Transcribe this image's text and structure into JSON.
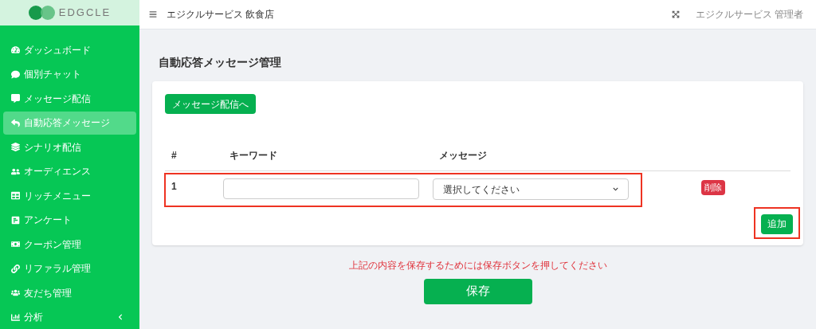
{
  "brand": {
    "name": "EDGCLE"
  },
  "sidebar": {
    "items": [
      {
        "label": "ダッシュボード",
        "selected": false,
        "kind": "link"
      },
      {
        "label": "個別チャット",
        "selected": false,
        "kind": "link"
      },
      {
        "label": "メッセージ配信",
        "selected": false,
        "kind": "link"
      },
      {
        "label": "自動応答メッセージ",
        "selected": true,
        "kind": "link"
      },
      {
        "label": "シナリオ配信",
        "selected": false,
        "kind": "link"
      },
      {
        "label": "オーディエンス",
        "selected": false,
        "kind": "link"
      },
      {
        "label": "リッチメニュー",
        "selected": false,
        "kind": "link"
      },
      {
        "label": "アンケート",
        "selected": false,
        "kind": "link"
      },
      {
        "label": "クーポン管理",
        "selected": false,
        "kind": "link"
      },
      {
        "label": "リファラル管理",
        "selected": false,
        "kind": "link"
      },
      {
        "label": "友だち管理",
        "selected": false,
        "kind": "link"
      },
      {
        "label": "分析",
        "selected": false,
        "kind": "group"
      }
    ]
  },
  "header": {
    "store": "エジクルサービス 飲食店",
    "user": "エジクルサービス 管理者"
  },
  "page_title": "自動応答メッセージ管理",
  "card": {
    "link_button": "メッセージ配信へ",
    "table": {
      "columns": [
        "#",
        "キーワード",
        "メッセージ"
      ],
      "rows": [
        {
          "number": "1",
          "message_select": "選択してください",
          "delete_button": "削除",
          "highlighted": true
        }
      ]
    },
    "add_button": {
      "label": "追加",
      "highlighted": true
    }
  },
  "notice": "上記の内容を保存するためには保存ボタンを押してください",
  "save_button": "保存"
}
